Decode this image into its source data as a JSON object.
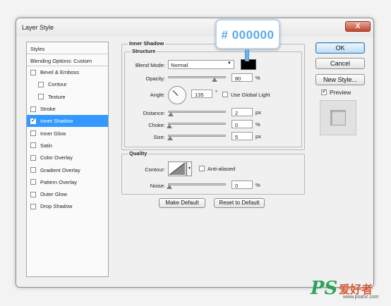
{
  "window": {
    "title": "Layer Style",
    "close_label": "X"
  },
  "styles_panel": {
    "header": "Styles",
    "blending_options": "Blending Options: Custom",
    "items": [
      {
        "label": "Bevel & Emboss",
        "checked": false,
        "indent": false,
        "selected": false
      },
      {
        "label": "Contour",
        "checked": false,
        "indent": true,
        "selected": false
      },
      {
        "label": "Texture",
        "checked": false,
        "indent": true,
        "selected": false
      },
      {
        "label": "Stroke",
        "checked": false,
        "indent": false,
        "selected": false
      },
      {
        "label": "Inner Shadow",
        "checked": true,
        "indent": false,
        "selected": true
      },
      {
        "label": "Inner Glow",
        "checked": false,
        "indent": false,
        "selected": false
      },
      {
        "label": "Satin",
        "checked": false,
        "indent": false,
        "selected": false
      },
      {
        "label": "Color Overlay",
        "checked": false,
        "indent": false,
        "selected": false
      },
      {
        "label": "Gradient Overlay",
        "checked": false,
        "indent": false,
        "selected": false
      },
      {
        "label": "Pattern Overlay",
        "checked": false,
        "indent": false,
        "selected": false
      },
      {
        "label": "Outer Glow",
        "checked": false,
        "indent": false,
        "selected": false
      },
      {
        "label": "Drop Shadow",
        "checked": false,
        "indent": false,
        "selected": false
      }
    ]
  },
  "inner_shadow": {
    "title": "Inner Shadow",
    "structure_title": "Structure",
    "blend_mode_label": "Blend Mode:",
    "blend_mode_value": "Normal",
    "shadow_color": "#000000",
    "opacity_label": "Opacity:",
    "opacity_value": "80",
    "opacity_unit": "%",
    "opacity_fraction": 0.8,
    "angle_label": "Angle:",
    "angle_value": "135",
    "angle_unit": "°",
    "use_global_light_label": "Use Global Light",
    "use_global_light": false,
    "distance_label": "Distance:",
    "distance_value": "2",
    "distance_unit": "px",
    "choke_label": "Choke:",
    "choke_value": "0",
    "choke_unit": "%",
    "size_label": "Size:",
    "size_value": "5",
    "size_unit": "px",
    "quality_title": "Quality",
    "contour_label": "Contour:",
    "anti_aliased_label": "Anti-aliased",
    "anti_aliased": false,
    "noise_label": "Noise:",
    "noise_value": "0",
    "noise_unit": "%",
    "make_default_label": "Make Default",
    "reset_default_label": "Reset to Default"
  },
  "buttons": {
    "ok": "OK",
    "cancel": "Cancel",
    "new_style": "New Style...",
    "preview_label": "Preview",
    "preview_checked": true
  },
  "callout": {
    "text": "# 000000"
  },
  "watermark": {
    "logo": "PS",
    "chinese": "爱好者",
    "url": "www.psahz.com"
  }
}
